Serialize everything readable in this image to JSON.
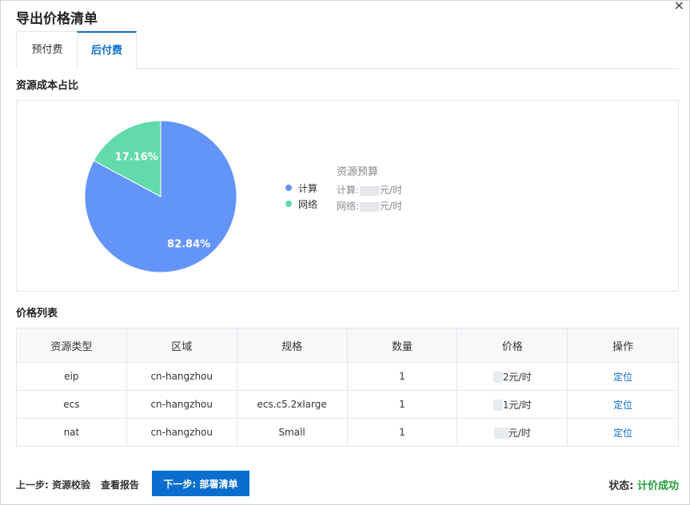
{
  "dialog": {
    "title": "导出价格清单",
    "close_icon": "×"
  },
  "tabs": [
    {
      "label": "预付费",
      "active": false
    },
    {
      "label": "后付费",
      "active": true
    }
  ],
  "cost_section": {
    "title": "资源成本占比"
  },
  "chart_data": {
    "type": "pie",
    "categories": [
      "计算",
      "网络"
    ],
    "values": [
      82.84,
      17.16
    ],
    "labels": [
      "82.84%",
      "17.16%"
    ],
    "colors": [
      "#6394f9",
      "#62daab"
    ],
    "legend": "right"
  },
  "budget": {
    "title": "资源预算",
    "compute_label": "计算:",
    "network_label": "网络:",
    "unit": "元/时"
  },
  "price_section": {
    "title": "价格列表"
  },
  "table": {
    "headers": [
      "资源类型",
      "区域",
      "规格",
      "数量",
      "价格",
      "操作"
    ],
    "rows": [
      {
        "type": "eip",
        "region": "cn-hangzhou",
        "spec": "",
        "qty": "1",
        "price": "2元/时",
        "action": "定位"
      },
      {
        "type": "ecs",
        "region": "cn-hangzhou",
        "spec": "ecs.c5.2xlarge",
        "qty": "1",
        "price": "1元/时",
        "action": "定位"
      },
      {
        "type": "nat",
        "region": "cn-hangzhou",
        "spec": "Small",
        "qty": "1",
        "price": "元/时",
        "action": "定位"
      }
    ]
  },
  "footer": {
    "prev_label": "上一步: 资源校验",
    "report_label": "查看报告",
    "next_label": "下一步: 部署清单",
    "status_label": "状态:",
    "status_value": "计价成功",
    "status_color": "#1f9d36"
  }
}
